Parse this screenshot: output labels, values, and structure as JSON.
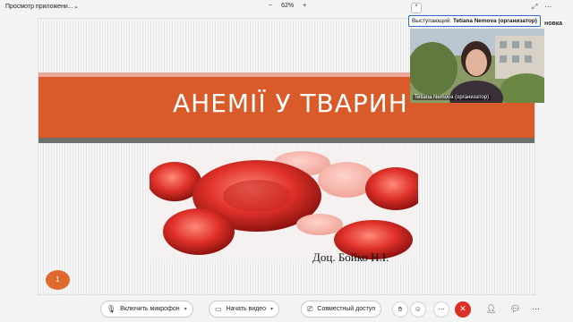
{
  "topbar": {
    "app_title": "Просмотр приложени...",
    "zoom_minus": "−",
    "zoom_level": "62%",
    "zoom_plus": "+"
  },
  "slide": {
    "title": "АНЕМІЇ У ТВАРИН",
    "author": "Доц. Бойко Н.І.",
    "page_number": "1"
  },
  "speaker": {
    "label_prefix": "Выступающий:",
    "label_name": "Tetiana Nemova (организатор)",
    "video_name": "Tetiana Nemova (организатор)",
    "side_text": "новка"
  },
  "toolbar": {
    "mic_label": "Включить микрофон",
    "video_label": "Начать видео",
    "share_label": "Совместный доступ"
  },
  "colors": {
    "band": "#d95b2a",
    "badge": "#e06a2d",
    "end_call": "#d93025",
    "speaker_border": "#2b6cd4"
  }
}
